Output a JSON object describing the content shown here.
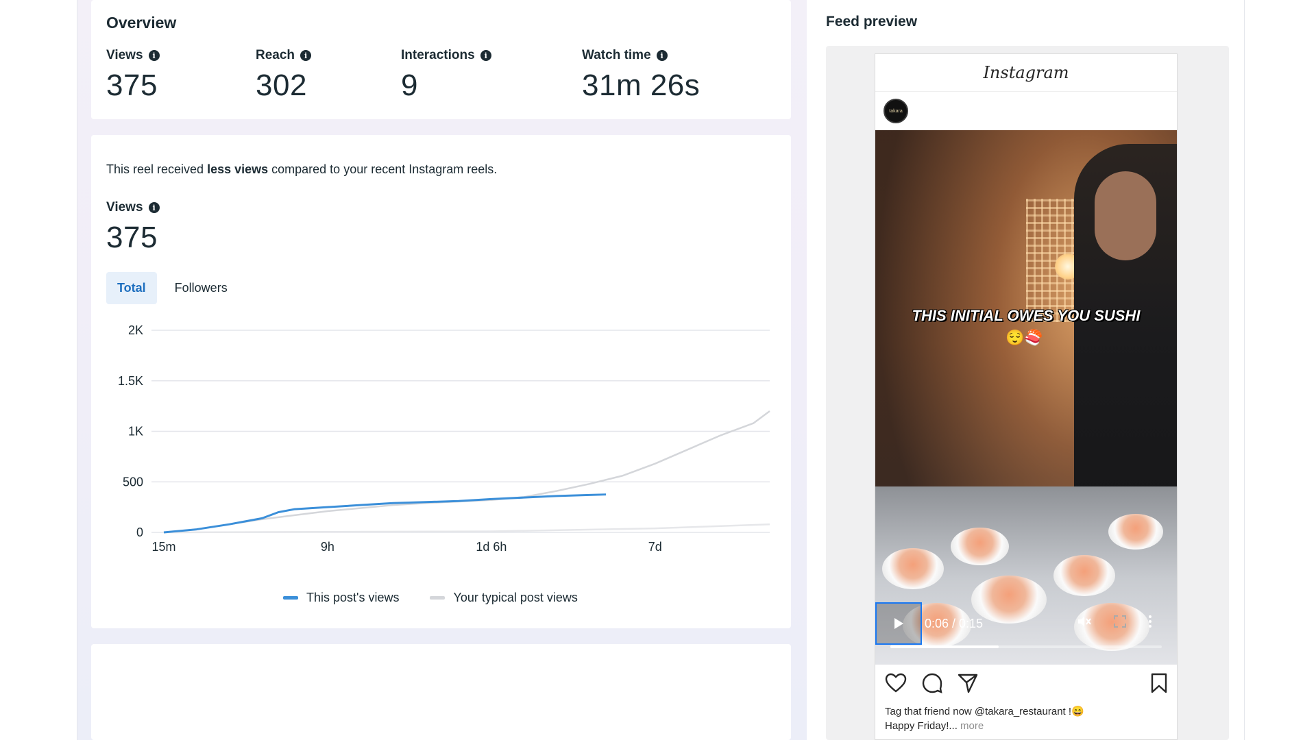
{
  "overview": {
    "title": "Overview",
    "metrics": [
      {
        "label": "Views",
        "value": "375"
      },
      {
        "label": "Reach",
        "value": "302"
      },
      {
        "label": "Interactions",
        "value": "9"
      },
      {
        "label": "Watch time",
        "value": "31m 26s"
      }
    ]
  },
  "chart_card": {
    "compare_prefix": "This reel received ",
    "compare_bold": "less views",
    "compare_suffix": " compared to your recent Instagram reels.",
    "views_label": "Views",
    "views_value": "375",
    "tabs": [
      {
        "label": "Total",
        "active": true
      },
      {
        "label": "Followers",
        "active": false
      }
    ]
  },
  "chart_data": {
    "type": "line",
    "title": "",
    "xlabel": "",
    "ylabel": "",
    "ylim": [
      0,
      2000
    ],
    "y_ticks": [
      0,
      500,
      1000,
      1500,
      2000
    ],
    "y_tick_labels": [
      "0",
      "500",
      "1K",
      "1.5K",
      "2K"
    ],
    "x_tick_labels": [
      "15m",
      "9h",
      "1d 6h",
      "7d"
    ],
    "grid": true,
    "legend_placement": "bottom",
    "x_note": "x is index on a non-linear time axis: 0 = 15m, 10 = 9h, 20 = 1d 6h, 30 = 7d, 37 = right edge",
    "series": [
      {
        "name": "This post's views",
        "color": "#3b8fd9",
        "x": [
          0,
          2,
          4,
          6,
          7,
          8,
          10,
          12,
          14,
          16,
          18,
          20,
          22,
          24,
          26,
          27
        ],
        "y": [
          0,
          30,
          80,
          140,
          200,
          230,
          250,
          270,
          290,
          300,
          310,
          330,
          345,
          360,
          370,
          375
        ]
      },
      {
        "name": "Your typical post views",
        "color": "#d4d6da",
        "x": [
          0,
          2,
          4,
          6,
          8,
          10,
          12,
          14,
          16,
          18,
          20,
          22,
          24,
          26,
          28,
          30,
          32,
          34,
          36,
          37
        ],
        "y": [
          0,
          30,
          80,
          130,
          170,
          210,
          240,
          270,
          290,
          305,
          320,
          350,
          410,
          480,
          560,
          680,
          820,
          960,
          1080,
          1200
        ]
      },
      {
        "name": "",
        "color": "#e6e7ea",
        "x": [
          0,
          10,
          20,
          30,
          37
        ],
        "y": [
          0,
          5,
          10,
          40,
          80
        ]
      }
    ]
  },
  "feed_preview": {
    "title": "Feed preview",
    "app_name": "Instagram",
    "avatar_text": "takara",
    "overlay_text": "THIS INITIAL OWES YOU SUSHI",
    "overlay_emoji": "😌🍣",
    "time": "0:06 / 0:15",
    "progress": 0.4,
    "caption_line1": "Tag that friend now @takara_restaurant !😄",
    "caption_line2": "Happy Friday!...",
    "more": "more"
  },
  "colors": {
    "accent": "#1e6fbf",
    "series_primary": "#3b8fd9",
    "series_typical": "#d4d6da"
  }
}
